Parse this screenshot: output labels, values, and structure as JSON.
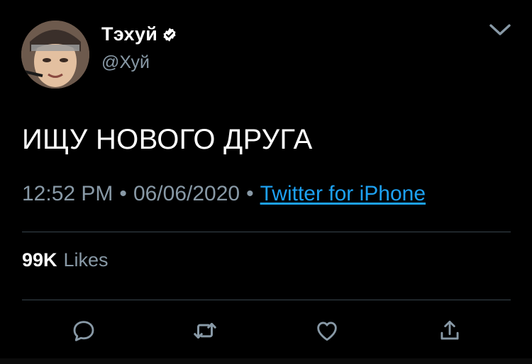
{
  "author": {
    "display_name": "Тэхуй",
    "handle": "@Хуй",
    "verified_icon": "verified-badge-icon",
    "avatar": "profile-photo"
  },
  "tweet": {
    "text": "ИЩУ НОВОГО ДРУГА",
    "time": "12:52 PM",
    "separator": "•",
    "date": "06/06/2020",
    "source": "Twitter for iPhone"
  },
  "stats": {
    "likes_count": "99K",
    "likes_label": "Likes"
  },
  "actions": [
    {
      "name": "reply",
      "icon": "reply-icon"
    },
    {
      "name": "retweet",
      "icon": "retweet-icon"
    },
    {
      "name": "like",
      "icon": "heart-icon"
    },
    {
      "name": "share",
      "icon": "share-icon"
    }
  ],
  "menu": {
    "icon": "chevron-down-icon"
  },
  "colors": {
    "background": "#000000",
    "text_primary": "#ffffff",
    "text_secondary": "#8899a6",
    "link": "#1da1f2",
    "divider": "#38444d"
  }
}
